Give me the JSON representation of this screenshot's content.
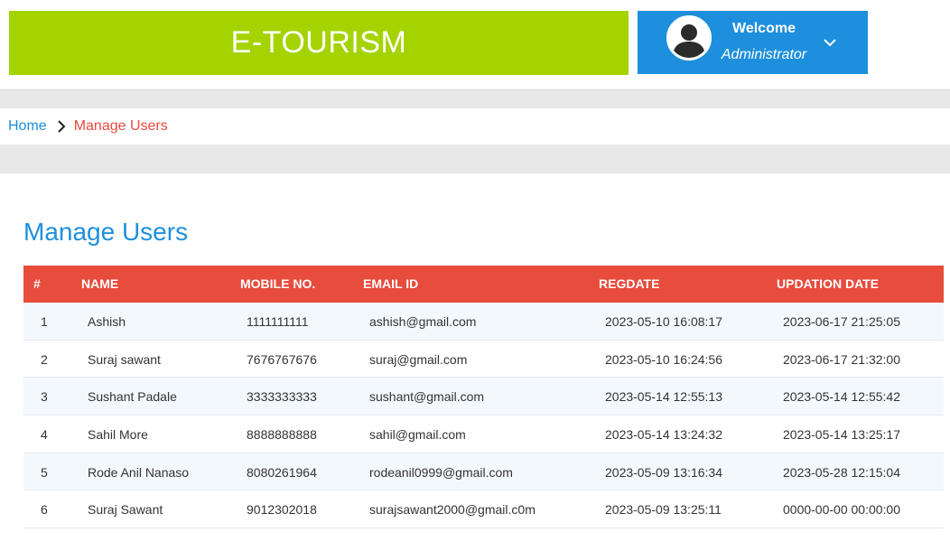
{
  "header": {
    "brand": "E-TOURISM",
    "welcome": "Welcome",
    "role": "Administrator",
    "avatar_icon": "user-avatar-icon",
    "menu_icon": "chevron-down-icon"
  },
  "breadcrumb": {
    "home": "Home",
    "separator_icon": "chevron-right-icon",
    "current": "Manage Users"
  },
  "page": {
    "title": "Manage Users"
  },
  "table": {
    "columns": [
      "#",
      "NAME",
      "MOBILE NO.",
      "EMAIL ID",
      "REGDATE",
      "UPDATION DATE"
    ],
    "rows": [
      [
        "1",
        "Ashish",
        "1111111111",
        "ashish@gmail.com",
        "2023-05-10 16:08:17",
        "2023-06-17 21:25:05"
      ],
      [
        "2",
        "Suraj sawant",
        "7676767676",
        "suraj@gmail.com",
        "2023-05-10 16:24:56",
        "2023-06-17 21:32:00"
      ],
      [
        "3",
        "Sushant Padale",
        "3333333333",
        "sushant@gmail.com",
        "2023-05-14 12:55:13",
        "2023-05-14 12:55:42"
      ],
      [
        "4",
        "Sahil More",
        "8888888888",
        "sahil@gmail.com",
        "2023-05-14 13:24:32",
        "2023-05-14 13:25:17"
      ],
      [
        "5",
        "Rode Anil Nanaso",
        "8080261964",
        "rodeanil0999@gmail.com",
        "2023-05-09 13:16:34",
        "2023-05-28 12:15:04"
      ],
      [
        "6",
        "Suraj Sawant",
        "9012302018",
        "surajsawant2000@gmail.c0m",
        "2023-05-09 13:25:11",
        "0000-00-00 00:00:00"
      ]
    ]
  },
  "colors": {
    "brand_green": "#a4d300",
    "header_blue": "#1e8fdc",
    "table_header_red": "#e74c3c"
  }
}
